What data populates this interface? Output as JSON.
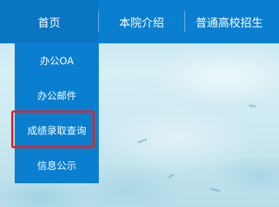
{
  "nav": {
    "items": [
      {
        "label": "首页"
      },
      {
        "label": "本院介绍"
      },
      {
        "label": "普通高校招生"
      }
    ]
  },
  "dropdown": {
    "items": [
      {
        "label": "办公OA"
      },
      {
        "label": "办公邮件"
      },
      {
        "label": "成绩录取查询"
      },
      {
        "label": "信息公示"
      }
    ]
  },
  "colors": {
    "nav_bg": "#0a7fd0",
    "highlight_border": "#e52222"
  }
}
